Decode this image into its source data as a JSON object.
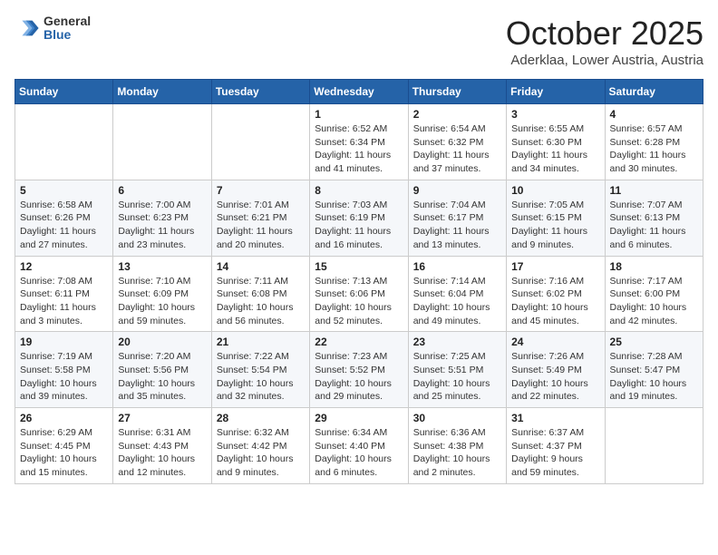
{
  "logo": {
    "general": "General",
    "blue": "Blue"
  },
  "header": {
    "month": "October 2025",
    "location": "Aderklaa, Lower Austria, Austria"
  },
  "weekdays": [
    "Sunday",
    "Monday",
    "Tuesday",
    "Wednesday",
    "Thursday",
    "Friday",
    "Saturday"
  ],
  "weeks": [
    [
      {
        "day": "",
        "info": ""
      },
      {
        "day": "",
        "info": ""
      },
      {
        "day": "",
        "info": ""
      },
      {
        "day": "1",
        "info": "Sunrise: 6:52 AM\nSunset: 6:34 PM\nDaylight: 11 hours\nand 41 minutes."
      },
      {
        "day": "2",
        "info": "Sunrise: 6:54 AM\nSunset: 6:32 PM\nDaylight: 11 hours\nand 37 minutes."
      },
      {
        "day": "3",
        "info": "Sunrise: 6:55 AM\nSunset: 6:30 PM\nDaylight: 11 hours\nand 34 minutes."
      },
      {
        "day": "4",
        "info": "Sunrise: 6:57 AM\nSunset: 6:28 PM\nDaylight: 11 hours\nand 30 minutes."
      }
    ],
    [
      {
        "day": "5",
        "info": "Sunrise: 6:58 AM\nSunset: 6:26 PM\nDaylight: 11 hours\nand 27 minutes."
      },
      {
        "day": "6",
        "info": "Sunrise: 7:00 AM\nSunset: 6:23 PM\nDaylight: 11 hours\nand 23 minutes."
      },
      {
        "day": "7",
        "info": "Sunrise: 7:01 AM\nSunset: 6:21 PM\nDaylight: 11 hours\nand 20 minutes."
      },
      {
        "day": "8",
        "info": "Sunrise: 7:03 AM\nSunset: 6:19 PM\nDaylight: 11 hours\nand 16 minutes."
      },
      {
        "day": "9",
        "info": "Sunrise: 7:04 AM\nSunset: 6:17 PM\nDaylight: 11 hours\nand 13 minutes."
      },
      {
        "day": "10",
        "info": "Sunrise: 7:05 AM\nSunset: 6:15 PM\nDaylight: 11 hours\nand 9 minutes."
      },
      {
        "day": "11",
        "info": "Sunrise: 7:07 AM\nSunset: 6:13 PM\nDaylight: 11 hours\nand 6 minutes."
      }
    ],
    [
      {
        "day": "12",
        "info": "Sunrise: 7:08 AM\nSunset: 6:11 PM\nDaylight: 11 hours\nand 3 minutes."
      },
      {
        "day": "13",
        "info": "Sunrise: 7:10 AM\nSunset: 6:09 PM\nDaylight: 10 hours\nand 59 minutes."
      },
      {
        "day": "14",
        "info": "Sunrise: 7:11 AM\nSunset: 6:08 PM\nDaylight: 10 hours\nand 56 minutes."
      },
      {
        "day": "15",
        "info": "Sunrise: 7:13 AM\nSunset: 6:06 PM\nDaylight: 10 hours\nand 52 minutes."
      },
      {
        "day": "16",
        "info": "Sunrise: 7:14 AM\nSunset: 6:04 PM\nDaylight: 10 hours\nand 49 minutes."
      },
      {
        "day": "17",
        "info": "Sunrise: 7:16 AM\nSunset: 6:02 PM\nDaylight: 10 hours\nand 45 minutes."
      },
      {
        "day": "18",
        "info": "Sunrise: 7:17 AM\nSunset: 6:00 PM\nDaylight: 10 hours\nand 42 minutes."
      }
    ],
    [
      {
        "day": "19",
        "info": "Sunrise: 7:19 AM\nSunset: 5:58 PM\nDaylight: 10 hours\nand 39 minutes."
      },
      {
        "day": "20",
        "info": "Sunrise: 7:20 AM\nSunset: 5:56 PM\nDaylight: 10 hours\nand 35 minutes."
      },
      {
        "day": "21",
        "info": "Sunrise: 7:22 AM\nSunset: 5:54 PM\nDaylight: 10 hours\nand 32 minutes."
      },
      {
        "day": "22",
        "info": "Sunrise: 7:23 AM\nSunset: 5:52 PM\nDaylight: 10 hours\nand 29 minutes."
      },
      {
        "day": "23",
        "info": "Sunrise: 7:25 AM\nSunset: 5:51 PM\nDaylight: 10 hours\nand 25 minutes."
      },
      {
        "day": "24",
        "info": "Sunrise: 7:26 AM\nSunset: 5:49 PM\nDaylight: 10 hours\nand 22 minutes."
      },
      {
        "day": "25",
        "info": "Sunrise: 7:28 AM\nSunset: 5:47 PM\nDaylight: 10 hours\nand 19 minutes."
      }
    ],
    [
      {
        "day": "26",
        "info": "Sunrise: 6:29 AM\nSunset: 4:45 PM\nDaylight: 10 hours\nand 15 minutes."
      },
      {
        "day": "27",
        "info": "Sunrise: 6:31 AM\nSunset: 4:43 PM\nDaylight: 10 hours\nand 12 minutes."
      },
      {
        "day": "28",
        "info": "Sunrise: 6:32 AM\nSunset: 4:42 PM\nDaylight: 10 hours\nand 9 minutes."
      },
      {
        "day": "29",
        "info": "Sunrise: 6:34 AM\nSunset: 4:40 PM\nDaylight: 10 hours\nand 6 minutes."
      },
      {
        "day": "30",
        "info": "Sunrise: 6:36 AM\nSunset: 4:38 PM\nDaylight: 10 hours\nand 2 minutes."
      },
      {
        "day": "31",
        "info": "Sunrise: 6:37 AM\nSunset: 4:37 PM\nDaylight: 9 hours\nand 59 minutes."
      },
      {
        "day": "",
        "info": ""
      }
    ]
  ]
}
